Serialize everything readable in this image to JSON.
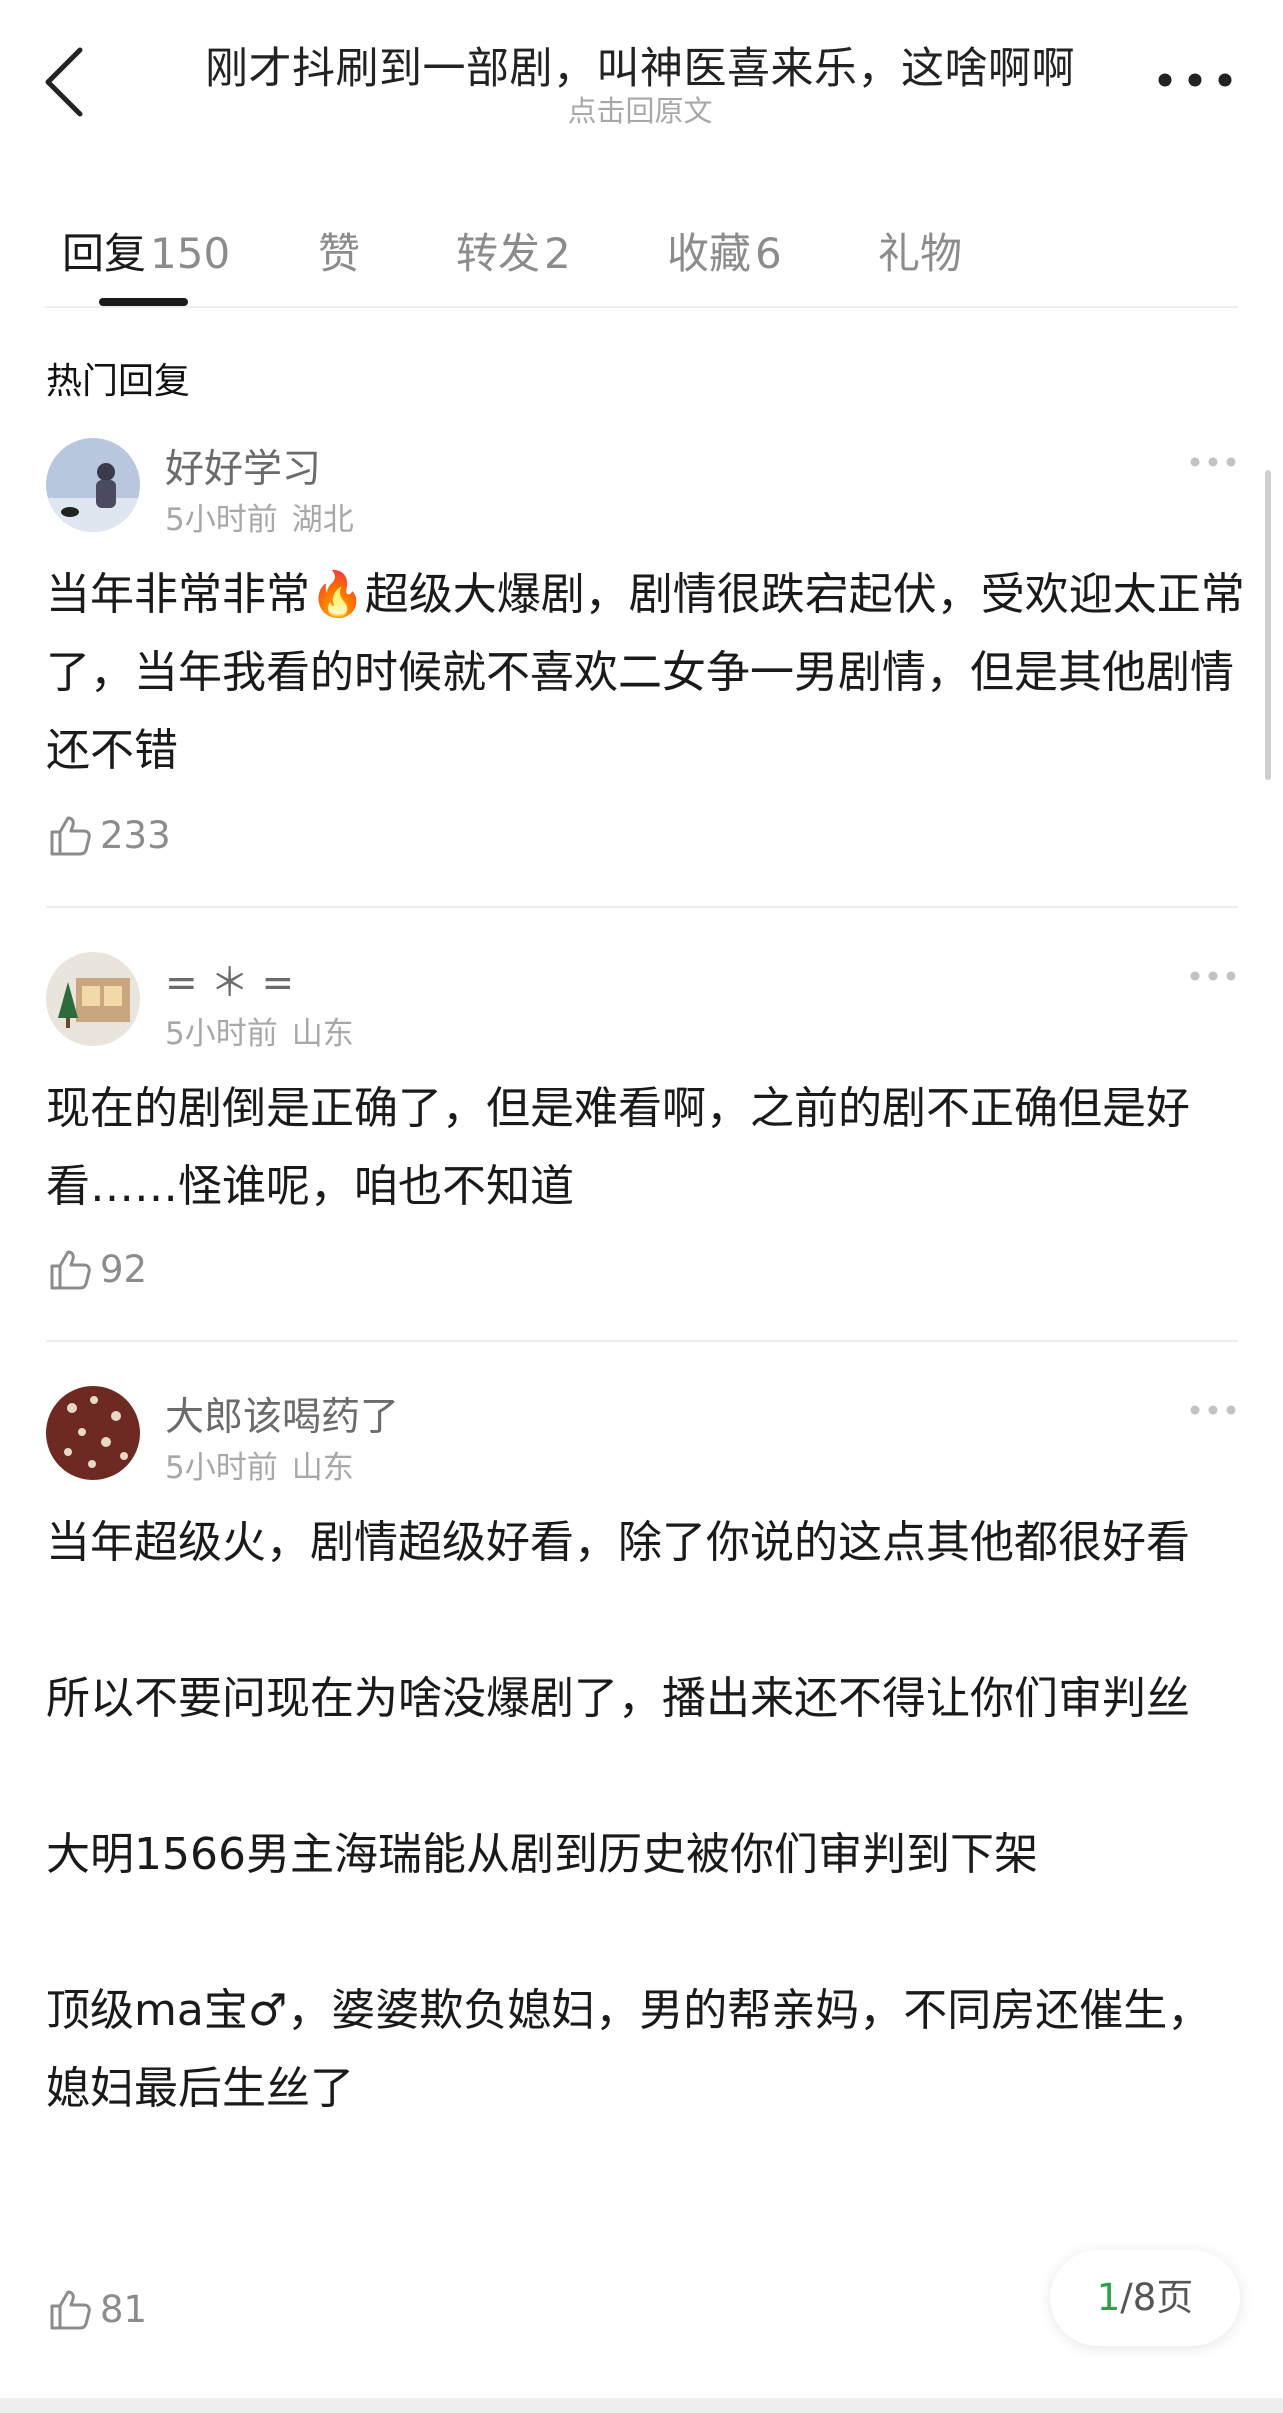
{
  "header": {
    "title": "刚才抖刷到一部剧，叫神医喜来乐，这啥啊啊",
    "subtitle": "点击回原文"
  },
  "tabs": [
    {
      "label": "回复",
      "count": "150"
    },
    {
      "label": "赞",
      "count": ""
    },
    {
      "label": "转发",
      "count": "2"
    },
    {
      "label": "收藏",
      "count": "6"
    },
    {
      "label": "礼物",
      "count": ""
    }
  ],
  "section_title": "热门回复",
  "comments": [
    {
      "username": "好好学习",
      "time": "5小时前",
      "location": "湖北",
      "paragraphs": [
        "当年非常非常🔥超级大爆剧，剧情很跌宕起伏，受欢迎太正常了，当年我看的时候就不喜欢二女争一男剧情，但是其他剧情还不错"
      ],
      "likes": "233"
    },
    {
      "username": "= ＊ =",
      "time": "5小时前",
      "location": "山东",
      "paragraphs": [
        "现在的剧倒是正确了，但是难看啊，之前的剧不正确但是好看……怪谁呢，咱也不知道"
      ],
      "likes": "92"
    },
    {
      "username": "大郎该喝药了",
      "time": "5小时前",
      "location": "山东",
      "paragraphs": [
        "当年超级火，剧情超级好看，除了你说的这点其他都很好看",
        "所以不要问现在为啥没爆剧了，播出来还不得让你们审判丝",
        "大明1566男主海瑞能从剧到历史被你们审判到下架",
        "顶级ma宝♂，婆婆欺负媳妇，男的帮亲妈，不同房还催生，媳妇最后生丝了"
      ],
      "likes": "81"
    }
  ],
  "pager": {
    "current": "1",
    "total": "/8页"
  },
  "colors": {
    "accent_green": "#2aa24a",
    "text": "#1a1a1a",
    "muted": "#a8a8a8"
  }
}
